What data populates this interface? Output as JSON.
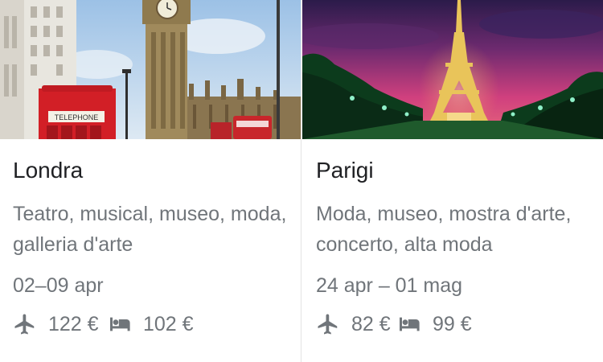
{
  "destinations": [
    {
      "city": "Londra",
      "tags": "Teatro, musical, museo, moda, galleria d'arte",
      "dates": "02–09 apr",
      "flight_price": "122 €",
      "hotel_price": "102 €",
      "flight_icon": "airplane-icon",
      "hotel_icon": "bed-icon"
    },
    {
      "city": "Parigi",
      "tags": "Moda, museo, mostra d'arte, concerto, alta moda",
      "dates": "24 apr – 01 mag",
      "flight_price": "82 €",
      "hotel_price": "99 €",
      "flight_icon": "airplane-icon",
      "hotel_icon": "bed-icon"
    }
  ],
  "colors": {
    "title": "#202124",
    "secondary": "#70757a",
    "divider": "#e3e3e3"
  }
}
